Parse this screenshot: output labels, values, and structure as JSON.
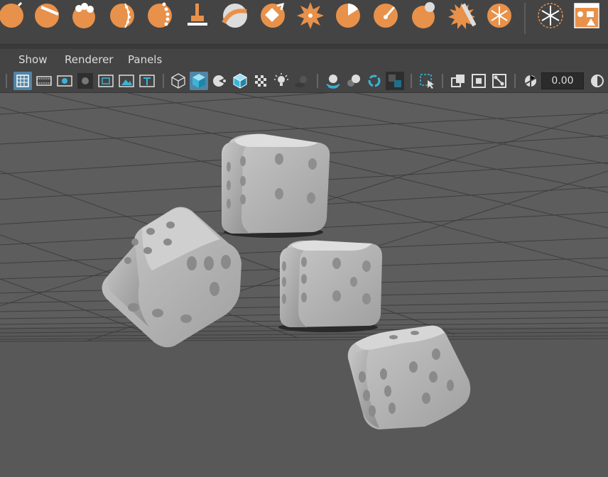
{
  "menubar": {
    "items": [
      "Show",
      "Renderer",
      "Panels"
    ]
  },
  "toolbar": {
    "value": "0.00"
  },
  "colors": {
    "shelf_icon": "#e8914a",
    "active_button": "#5285a6",
    "viewport_bg": "#5d5d5d",
    "panel_bg": "#444444"
  },
  "shelf_icons": [
    "sphere-icon",
    "cylinder-cut-icon",
    "cloud-sphere-icon",
    "spiral-sphere-icon",
    "chain-sphere-icon",
    "stamp-icon",
    "sculpt-curve-icon",
    "diamond-arrow-icon",
    "starburst-icon",
    "pie-sphere-icon",
    "knife-sphere-icon",
    "pinch-sphere-icon",
    "spiky-sphere-icon",
    "snowflake-sphere-icon",
    "snowflake-outline-icon",
    "shapes-window-icon"
  ],
  "toolbar_icons": [
    "grid-icon",
    "film-gate-icon",
    "resolution-gate-icon",
    "gate-mask-icon",
    "field-chart-icon",
    "safe-action-icon",
    "safe-title-icon",
    "wireframe-cube-icon",
    "shaded-cube-icon",
    "smooth-shaded-icon",
    "wireframe-on-shaded-icon",
    "textured-icon",
    "light-bulb-icon",
    "shadows-icon",
    "ambient-occlusion-icon",
    "motion-blur-icon",
    "anti-alias-icon",
    "depth-of-field-icon",
    "isolate-select-icon",
    "xray-icon",
    "xray-active-icon",
    "xray-joints-icon",
    "exposure-icon",
    "gamma-icon"
  ]
}
